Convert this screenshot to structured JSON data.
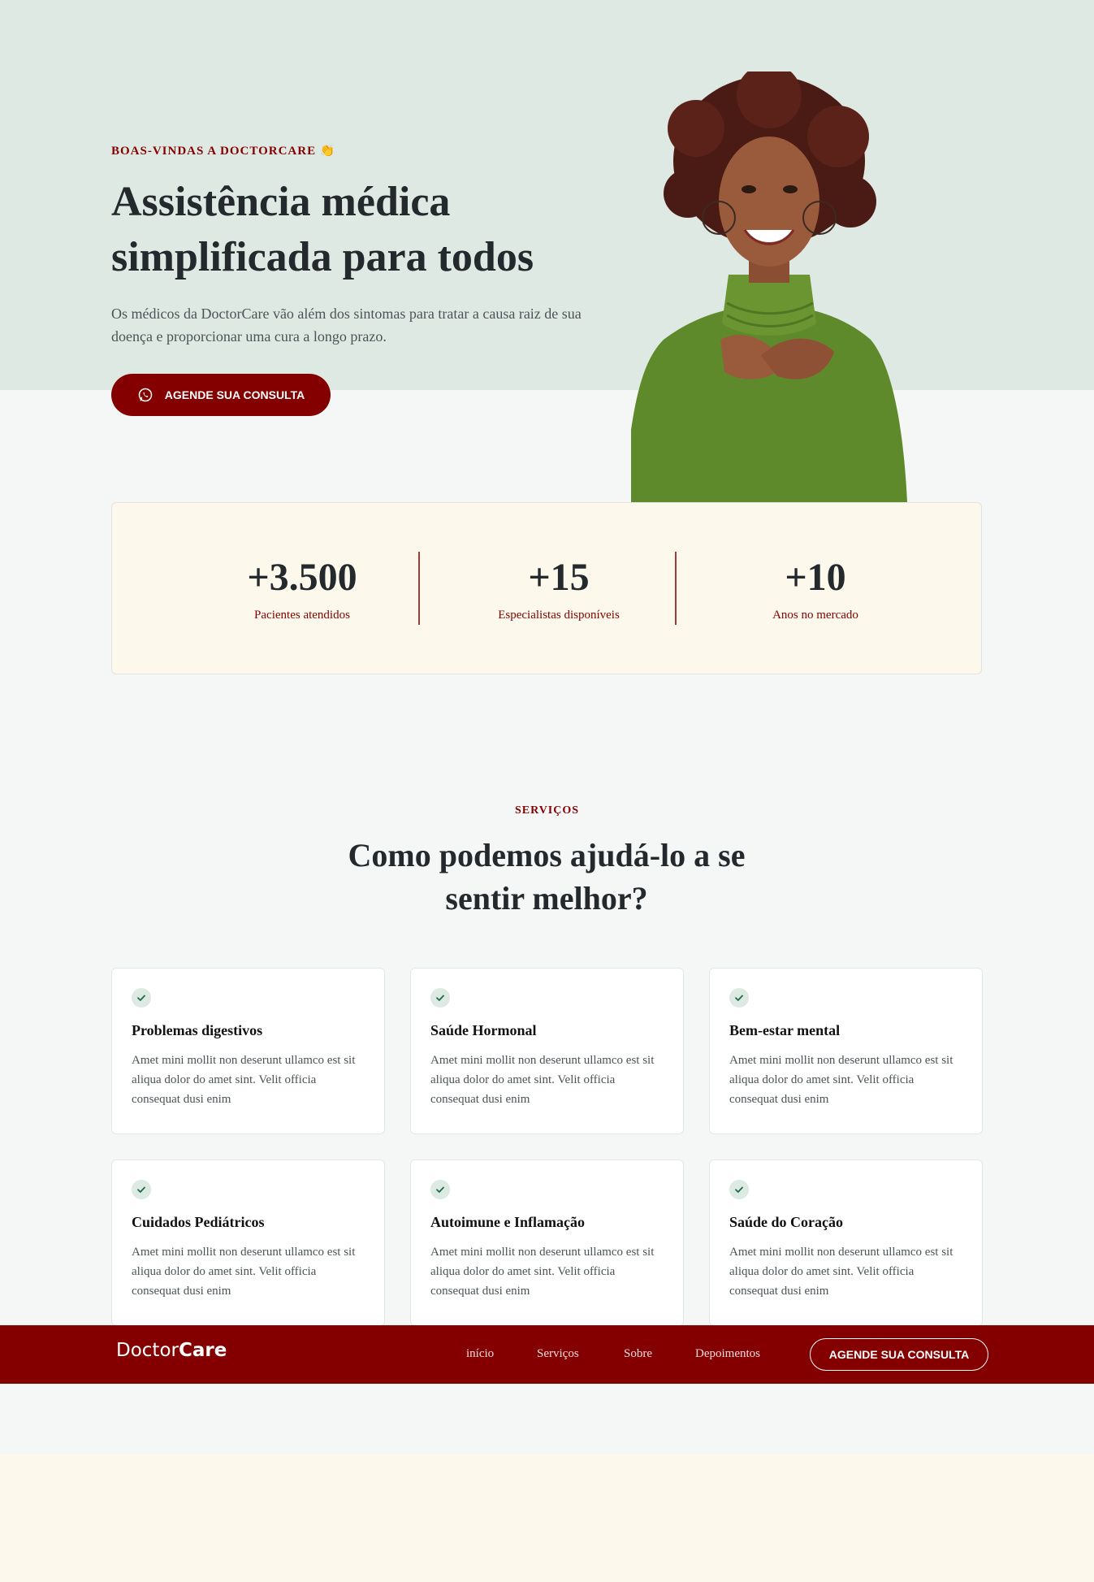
{
  "hero": {
    "eyebrow": "BOAS-VINDAS A DOCTORCARE 👏",
    "title": "Assistência médica simplificada para todos",
    "text": "Os médicos da DoctorCare vão além dos sintomas para tratar a causa raiz de sua doença e proporcionar uma cura a longo prazo.",
    "cta_label": "AGENDE SUA CONSULTA",
    "cta_icon": "whatsapp-icon"
  },
  "stats": [
    {
      "value": "+3.500",
      "label": "Pacientes atendidos"
    },
    {
      "value": "+15",
      "label": "Especialistas disponíveis"
    },
    {
      "value": "+10",
      "label": "Anos no mercado"
    }
  ],
  "services": {
    "eyebrow": "SERVIÇOS",
    "title": "Como podemos ajudá-lo a se sentir melhor?",
    "cards": [
      {
        "title": "Problemas digestivos",
        "text": "Amet mini mollit non deserunt ullamco est sit aliqua dolor do amet sint. Velit officia consequat dusi enim"
      },
      {
        "title": "Saúde Hormonal",
        "text": "Amet mini mollit non deserunt ullamco est sit aliqua dolor do amet sint. Velit officia consequat dusi enim"
      },
      {
        "title": "Bem-estar mental",
        "text": "Amet mini mollit non deserunt ullamco est sit aliqua dolor do amet sint. Velit officia consequat dusi enim"
      },
      {
        "title": "Cuidados Pediátricos",
        "text": "Amet mini mollit non deserunt ullamco est sit aliqua dolor do amet sint. Velit officia consequat dusi enim"
      },
      {
        "title": "Autoimune e Inflamação",
        "text": "Amet mini mollit non deserunt ullamco est sit aliqua dolor do amet sint. Velit officia consequat dusi enim"
      },
      {
        "title": "Saúde do Coração",
        "text": "Amet mini mollit non deserunt ullamco est sit aliqua dolor do amet sint. Velit officia consequat dusi enim"
      }
    ]
  },
  "navbar": {
    "logo_regular": "Doctor",
    "logo_bold": "Care",
    "items": [
      "início",
      "Serviços",
      "Sobre",
      "Depoimentos"
    ],
    "cta_label": "AGENDE SUA CONSULTA"
  },
  "colors": {
    "brand": "#840000",
    "hero_bg": "#dfe9e3",
    "stats_bg": "#fdf8ec",
    "page_bg": "#f5f7f6"
  }
}
